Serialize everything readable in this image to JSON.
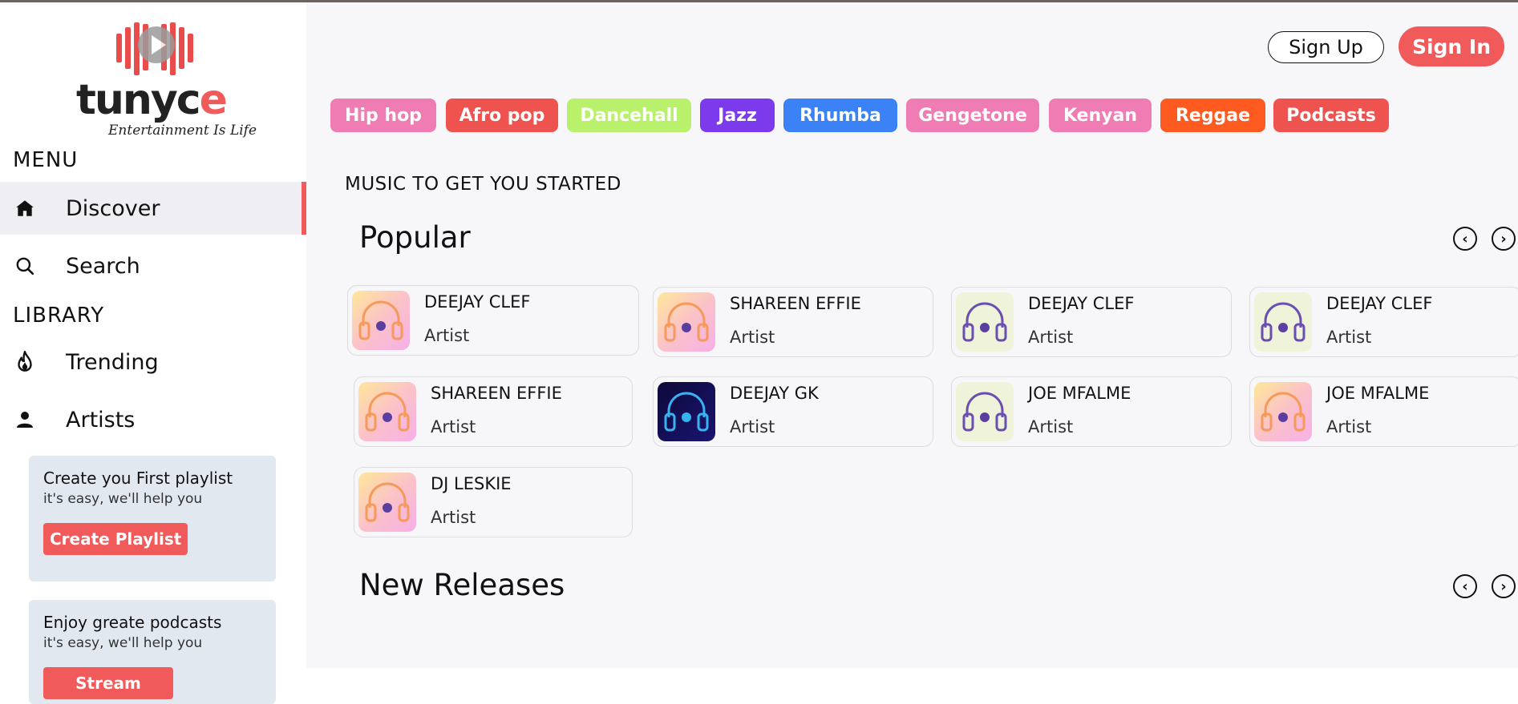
{
  "app": {
    "logo_text_main": "tunyc",
    "logo_text_accent": "e",
    "logo_tagline": "Entertainment Is Life"
  },
  "sidebar": {
    "menu_label": "MENU",
    "library_label": "LIBRARY",
    "items": [
      {
        "label": "Discover",
        "icon": "home-icon",
        "active": true
      },
      {
        "label": "Search",
        "icon": "search-icon",
        "active": false
      },
      {
        "label": "Trending",
        "icon": "fire-icon",
        "active": false
      },
      {
        "label": "Artists",
        "icon": "person-icon",
        "active": false
      }
    ],
    "promos": [
      {
        "title": "Create you First playlist",
        "subtitle": "it's easy, we'll help you",
        "button": "Create Playlist"
      },
      {
        "title": "Enjoy greate podcasts",
        "subtitle": "it's easy, we'll help you",
        "button": "Stream"
      }
    ]
  },
  "header": {
    "signup_label": "Sign Up",
    "signin_label": "Sign In"
  },
  "genres": [
    {
      "label": "Hip hop",
      "color": "#f07cb4"
    },
    {
      "label": "Afro pop",
      "color": "#ef5350"
    },
    {
      "label": "Dancehall",
      "color": "#b9f06c"
    },
    {
      "label": "Jazz",
      "color": "#7c3aed"
    },
    {
      "label": "Rhumba",
      "color": "#3b82f6"
    },
    {
      "label": "Gengetone",
      "color": "#f07cb4"
    },
    {
      "label": "Kenyan",
      "color": "#f07cb4"
    },
    {
      "label": "Reggae",
      "color": "#ff5a1f"
    },
    {
      "label": "Podcasts",
      "color": "#ef5350"
    }
  ],
  "main": {
    "intro": "MUSIC TO GET YOU STARTED",
    "popular_title": "Popular",
    "new_releases_title": "New Releases",
    "cards": [
      {
        "name": "DEEJAY CLEF",
        "role": "Artist",
        "thumb": "warm"
      },
      {
        "name": "SHAREEN EFFIE",
        "role": "Artist",
        "thumb": "warm"
      },
      {
        "name": "DEEJAY CLEF",
        "role": "Artist",
        "thumb": "pale"
      },
      {
        "name": "DEEJAY CLEF",
        "role": "Artist",
        "thumb": "pale"
      },
      {
        "name": "SHAREEN EFFIE",
        "role": "Artist",
        "thumb": "warm"
      },
      {
        "name": "DEEJAY GK",
        "role": "Artist",
        "thumb": "dark"
      },
      {
        "name": "JOE MFALME",
        "role": "Artist",
        "thumb": "pale"
      },
      {
        "name": "JOE MFALME",
        "role": "Artist",
        "thumb": "warm"
      },
      {
        "name": "DJ LESKIE",
        "role": "Artist",
        "thumb": "warm"
      }
    ]
  },
  "colors": {
    "accent": "#f15a5a",
    "sidebar_active_bg": "#efeff3",
    "main_bg": "#f7f7fa",
    "promo_bg": "#e2e8f0"
  }
}
